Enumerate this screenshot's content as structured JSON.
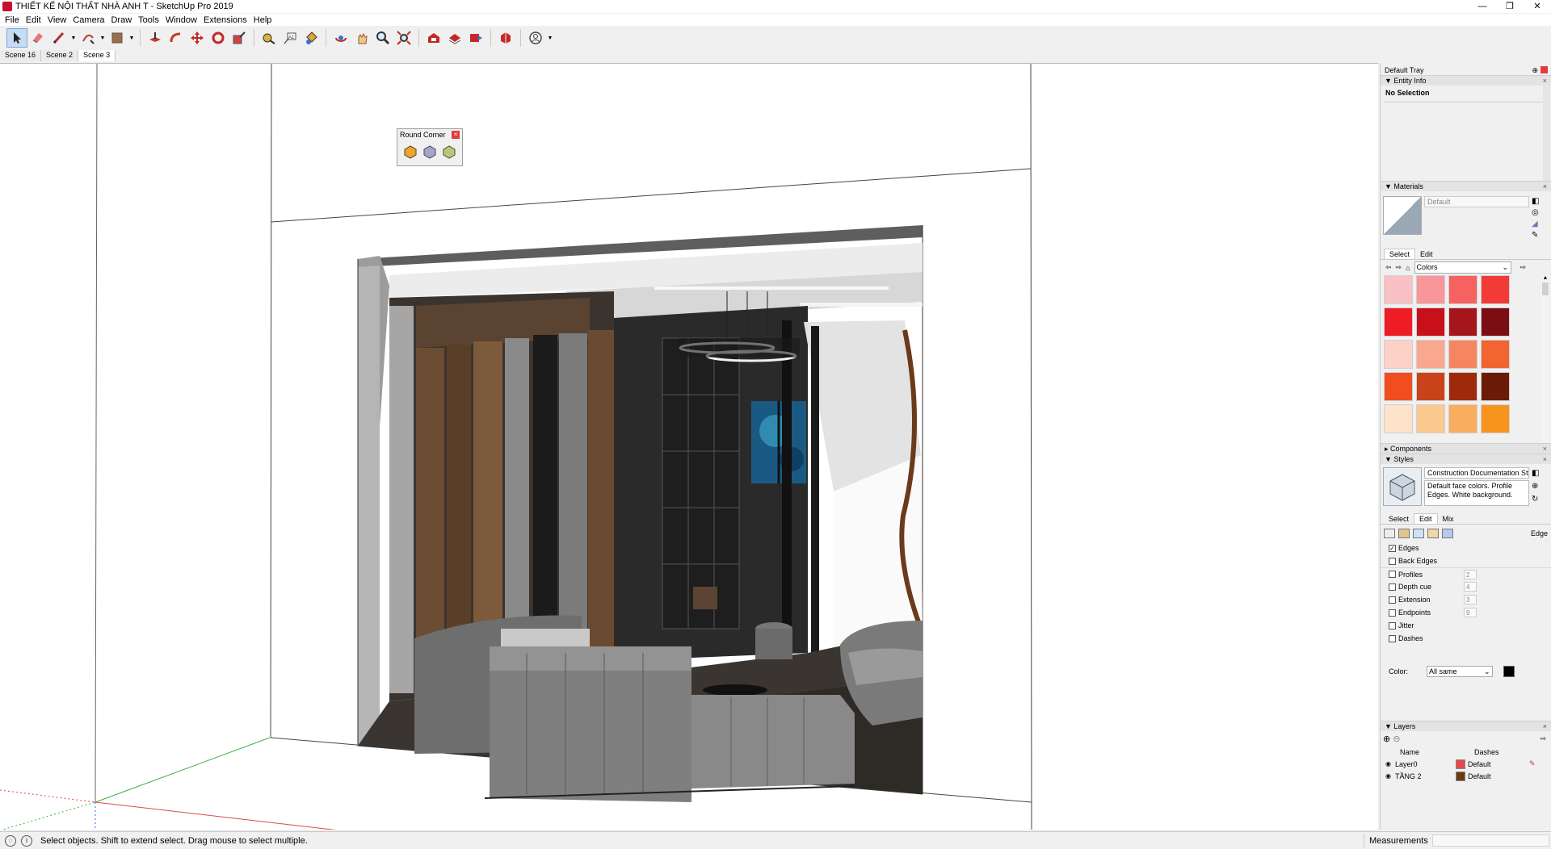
{
  "window": {
    "title": "THIẾT KẾ NỘI THẤT NHÀ ANH T - SketchUp Pro 2019",
    "controls": [
      "—",
      "❐",
      "✕"
    ]
  },
  "menu": [
    "File",
    "Edit",
    "View",
    "Camera",
    "Draw",
    "Tools",
    "Window",
    "Extensions",
    "Help"
  ],
  "scenes": [
    "Scene 16",
    "Scene 2",
    "Scene 3"
  ],
  "round_corner": {
    "title": "Round Corner",
    "close": "×"
  },
  "tray": {
    "title": "Default Tray",
    "entity_info": {
      "header": "Entity Info",
      "selection": "No Selection"
    },
    "materials": {
      "header": "Materials",
      "current": "Default",
      "tabs": [
        "Select",
        "Edit"
      ],
      "collection": "Colors",
      "swatches": [
        "#f9c1c3",
        "#f7979a",
        "#f5625f",
        "#f23b37",
        "#ee1c24",
        "#c8101a",
        "#a5161b",
        "#7a0e12",
        "#fcd2c7",
        "#f9a88f",
        "#f7855f",
        "#f26430",
        "#f04e1f",
        "#c8431a",
        "#9e2a0c",
        "#6a1c08",
        "#fde3c8",
        "#fbc98f",
        "#f9ad5e",
        "#f7941d"
      ]
    },
    "components": {
      "header": "Components"
    },
    "styles": {
      "header": "Styles",
      "name": "Construction Documentation Sty",
      "description": "Default face colors. Profile Edges. White background.",
      "tabs": [
        "Select",
        "Edit",
        "Mix"
      ],
      "section": "Edge",
      "checks": [
        {
          "label": "Edges",
          "checked": true,
          "value": ""
        },
        {
          "label": "Back Edges",
          "checked": false,
          "value": ""
        },
        {
          "label": "Profiles",
          "checked": false,
          "value": "2"
        },
        {
          "label": "Depth cue",
          "checked": false,
          "value": "4"
        },
        {
          "label": "Extension",
          "checked": false,
          "value": "3"
        },
        {
          "label": "Endpoints",
          "checked": false,
          "value": "9"
        },
        {
          "label": "Jitter",
          "checked": false,
          "value": ""
        },
        {
          "label": "Dashes",
          "checked": false,
          "value": ""
        }
      ],
      "color_label": "Color:",
      "color_value": "All same"
    },
    "layers": {
      "header": "Layers",
      "col_name": "Name",
      "col_dashes": "Dashes",
      "rows": [
        {
          "name": "Layer0",
          "color": "#e8474a",
          "dashes": "Default"
        },
        {
          "name": "TẦNG 2",
          "color": "#6b3a10",
          "dashes": "Default"
        }
      ]
    }
  },
  "status": {
    "text": "Select objects. Shift to extend select. Drag mouse to select multiple.",
    "measurements_label": "Measurements"
  }
}
